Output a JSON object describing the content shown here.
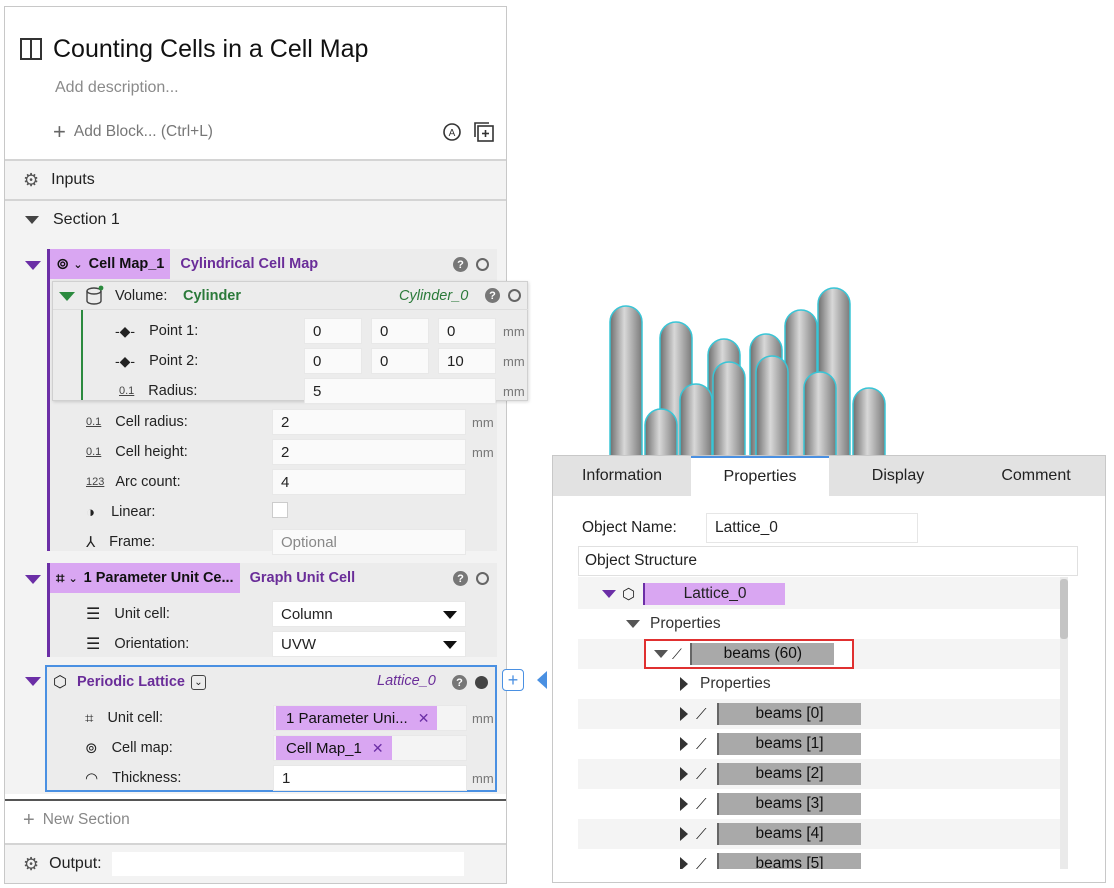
{
  "notebook": {
    "title": "Counting Cells in a Cell Map",
    "description_placeholder": "Add description...",
    "add_block": "Add Block... (Ctrl+L)",
    "inputs_label": "Inputs",
    "section_label": "Section 1",
    "new_section": "New Section",
    "output_label": "Output:"
  },
  "cell_map_block": {
    "name": "Cell Map_1",
    "type": "Cylindrical Cell Map",
    "volume": {
      "label": "Volume:",
      "type": "Cylinder",
      "ref": "Cylinder_0",
      "point1_label": "Point 1:",
      "point1": [
        "0",
        "0",
        "0"
      ],
      "point2_label": "Point 2:",
      "point2": [
        "0",
        "0",
        "10"
      ],
      "radius_label": "Radius:",
      "radius": "5",
      "unit": "mm"
    },
    "cell_radius_label": "Cell radius:",
    "cell_radius": "2",
    "cell_height_label": "Cell height:",
    "cell_height": "2",
    "arc_count_label": "Arc count:",
    "arc_count": "4",
    "linear_label": "Linear:",
    "frame_label": "Frame:",
    "frame_placeholder": "Optional",
    "unit": "mm"
  },
  "unit_cell_block": {
    "name": "1 Parameter Unit Ce...",
    "type": "Graph Unit Cell",
    "unit_cell_label": "Unit cell:",
    "unit_cell_value": "Column",
    "orientation_label": "Orientation:",
    "orientation_value": "UVW"
  },
  "lattice_block": {
    "name": "Periodic Lattice",
    "ref": "Lattice_0",
    "unit_cell_label": "Unit cell:",
    "unit_cell_chip": "1 Parameter Uni...",
    "cell_map_label": "Cell map:",
    "cell_map_chip": "Cell Map_1",
    "thickness_label": "Thickness:",
    "thickness": "1",
    "unit": "mm"
  },
  "properties_panel": {
    "tabs": [
      "Information",
      "Properties",
      "Display",
      "Comment"
    ],
    "active_tab": "Properties",
    "object_name_label": "Object Name:",
    "object_name": "Lattice_0",
    "structure_header": "Object Structure",
    "root": "Lattice_0",
    "properties_node": "Properties",
    "beams_node": "beams (60)",
    "sub_properties": "Properties",
    "beams": [
      "beams [0]",
      "beams [1]",
      "beams [2]",
      "beams [3]",
      "beams [4]",
      "beams [5]"
    ]
  },
  "colors": {
    "accent_purple": "#d9a6f2",
    "type_purple": "#6a2d99",
    "highlight_red": "#e03030",
    "selection_blue": "#4a90e2",
    "green": "#2b8a3e"
  }
}
